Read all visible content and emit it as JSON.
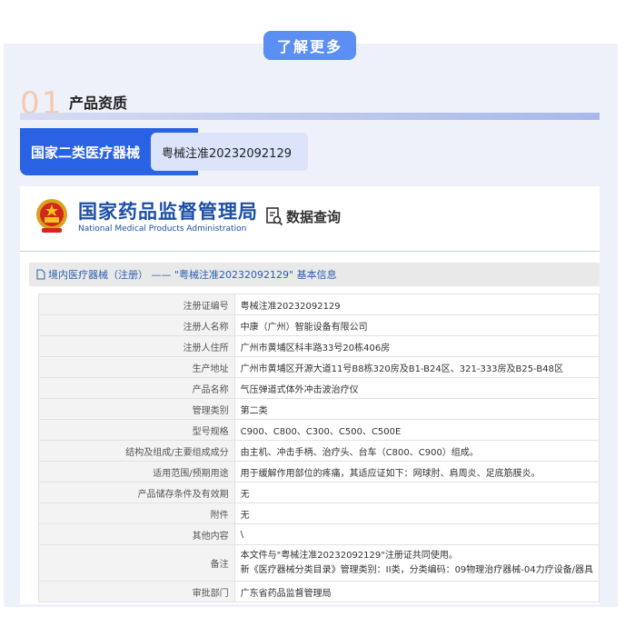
{
  "more_button": "了解更多",
  "section": {
    "number": "01",
    "title": "产品资质"
  },
  "classification_tag": "国家二类医疗器械",
  "registration_tag": "粤械注准20232092129",
  "nmpa": {
    "name_cn": "国家药品监督管理局",
    "name_en": "National Medical Products Administration",
    "query_label": "数据查询"
  },
  "info_title": "境内医疗器械（注册） —— \"粤械注准20232092129\" 基本信息",
  "rows": [
    {
      "label": "注册证编号",
      "value": "粤械注准20232092129"
    },
    {
      "label": "注册人名称",
      "value": "中康（广州）智能设备有限公司"
    },
    {
      "label": "注册人住所",
      "value": "广州市黄埔区科丰路33号20栋406房"
    },
    {
      "label": "生产地址",
      "value": "广州市黄埔区开源大道11号B8栋320房及B1-B24区、321-333房及B25-B48区"
    },
    {
      "label": "产品名称",
      "value": "气压弹道式体外冲击波治疗仪"
    },
    {
      "label": "管理类别",
      "value": "第二类"
    },
    {
      "label": "型号规格",
      "value": "C900、C800、C300、C500、C500E"
    },
    {
      "label": "结构及组成/主要组成成分",
      "value": "由主机、冲击手柄、治疗头、台车（C800、C900）组成。"
    },
    {
      "label": "适用范围/预期用途",
      "value": "用于缓解作用部位的疼痛，其适应证如下：网球肘、肩周炎、足底筋膜炎。"
    },
    {
      "label": "产品储存条件及有效期",
      "value": "无"
    },
    {
      "label": "附件",
      "value": "无"
    },
    {
      "label": "其他内容",
      "value": "\\"
    },
    {
      "label": "备注",
      "value_line1": "本文件与\"粤械注准20232092129\"注册证共同使用。",
      "value_line2": "新《医疗器械分类目录》管理类别：II类，分类编码：09物理治疗器械-04力疗设备/器具"
    },
    {
      "label": "审批部门",
      "value": "广东省药品监督管理局"
    }
  ]
}
